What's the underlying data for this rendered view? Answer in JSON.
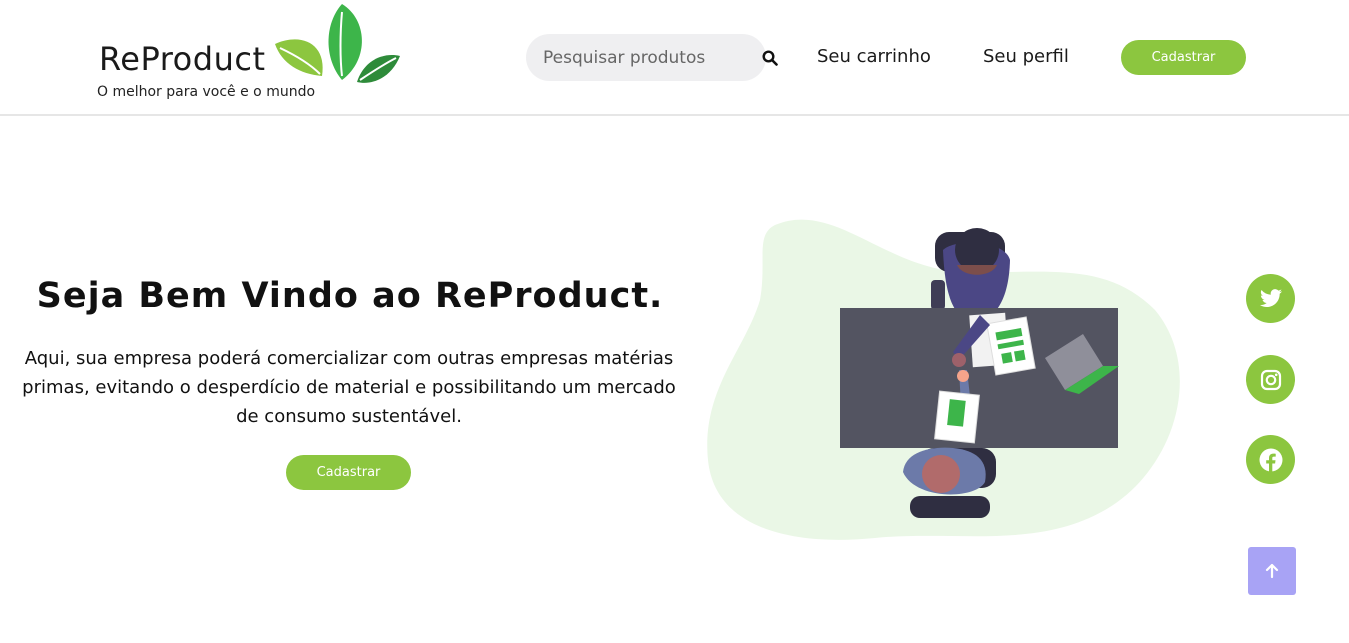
{
  "header": {
    "brand_name": "ReProduct",
    "tagline": "O melhor para você e o mundo",
    "search": {
      "placeholder": "Pesquisar produtos",
      "value": ""
    },
    "nav": {
      "cart_label": "Seu carrinho",
      "profile_label": "Seu perfil"
    },
    "signup_label": "Cadastrar"
  },
  "hero": {
    "title": "Seja Bem Vindo ao ReProduct.",
    "description": "Aqui, sua empresa poderá comercializar com outras empresas matérias primas, evitando o desperdício de material e possibilitando um mercado de consumo sustentável.",
    "signup_label": "Cadastrar"
  },
  "social": [
    {
      "name": "twitter-icon"
    },
    {
      "name": "instagram-icon"
    },
    {
      "name": "facebook-icon"
    }
  ],
  "colors": {
    "accent": "#8cc63f",
    "scroll_top": "#a8a3f5",
    "blob": "#eaf7e6",
    "table": "#535461"
  }
}
